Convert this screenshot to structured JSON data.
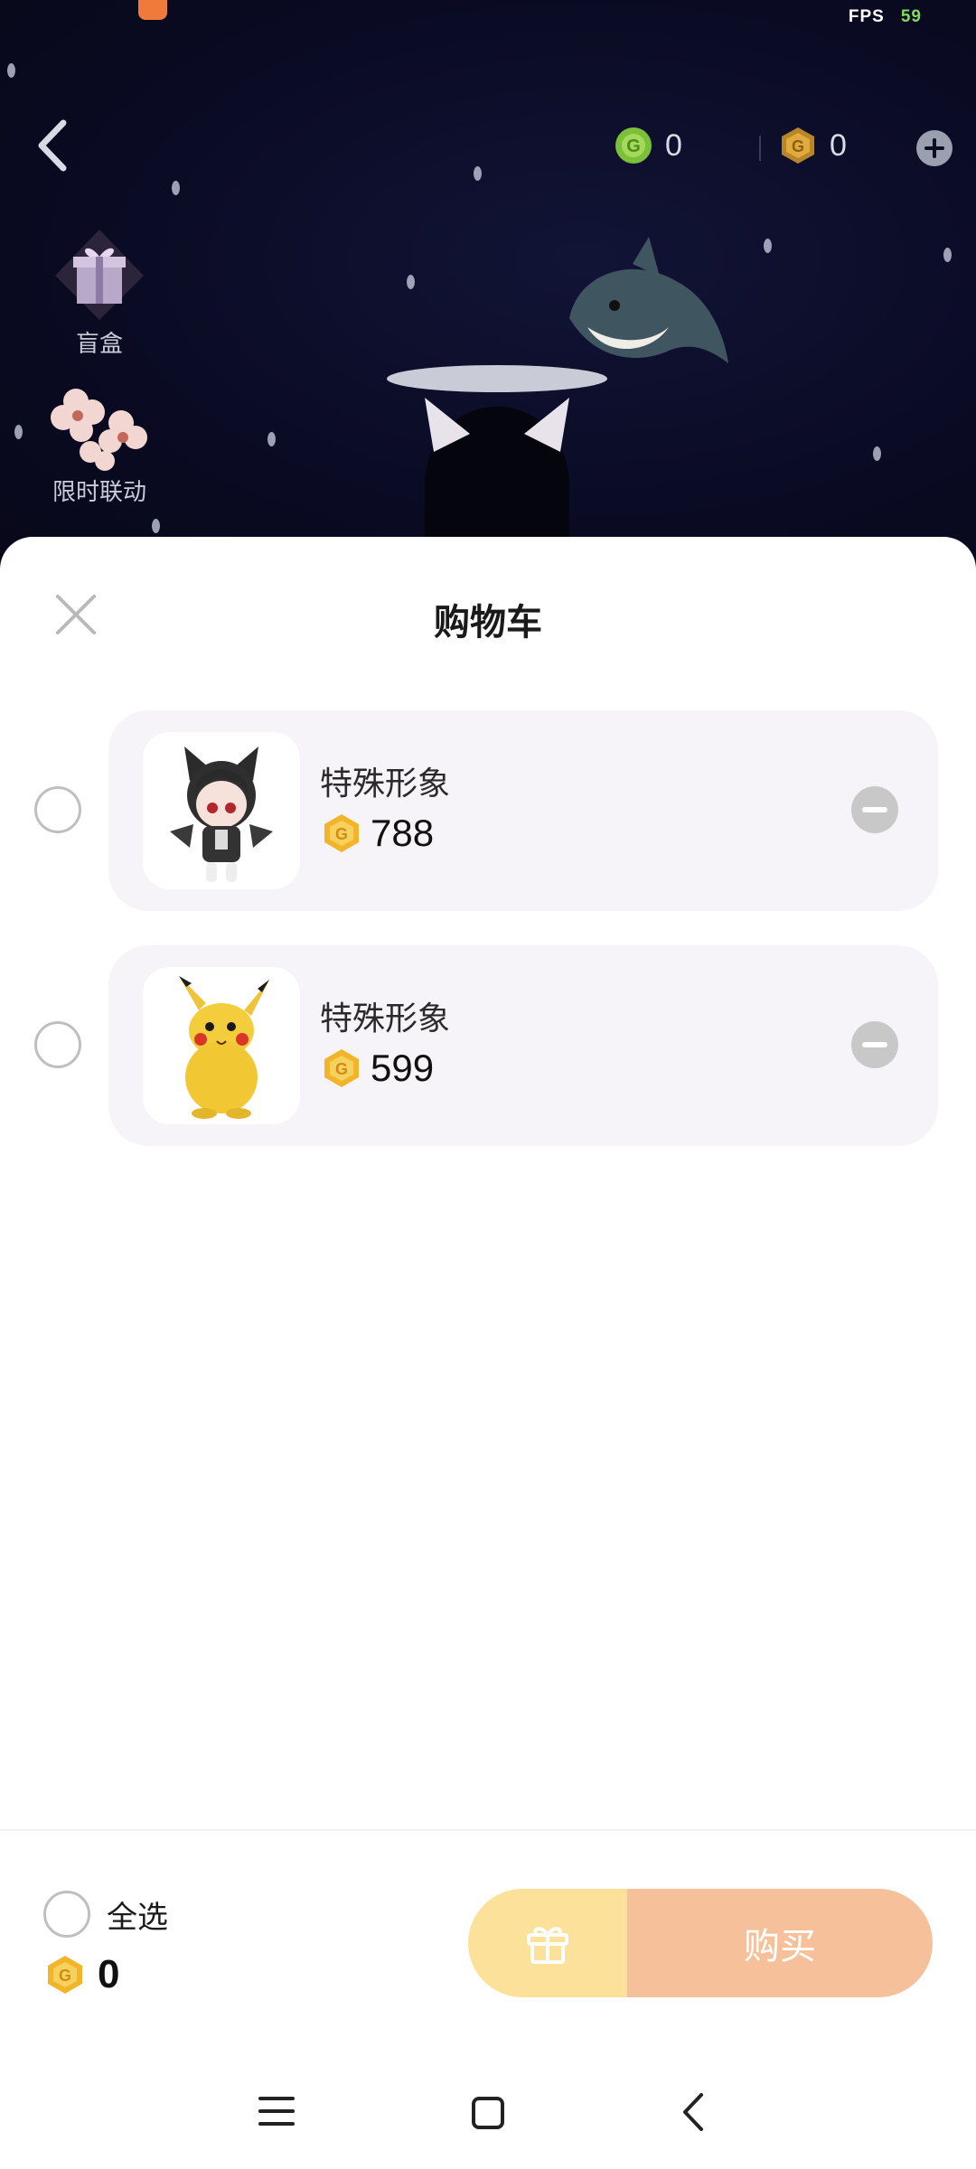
{
  "status_bar": {
    "fps_label": "FPS",
    "fps_value": "59"
  },
  "game_hud": {
    "currency_green": {
      "icon": "green-coin-icon",
      "amount": "0"
    },
    "currency_gold": {
      "icon": "gold-coin-icon",
      "amount": "0"
    },
    "side_entries": [
      {
        "label": "盲盒",
        "icon": "gift-box-icon"
      },
      {
        "label": "限时联动",
        "icon": "flower-icon"
      }
    ]
  },
  "cart": {
    "title": "购物车",
    "items": [
      {
        "name": "特殊形象",
        "price": "788",
        "currency_icon": "gold-coin-icon",
        "thumb": "cat-girl-avatar"
      },
      {
        "name": "特殊形象",
        "price": "599",
        "currency_icon": "gold-coin-icon",
        "thumb": "pikachu-avatar"
      }
    ],
    "select_all_label": "全选",
    "total": "0",
    "buy_label": "购买"
  },
  "colors": {
    "gift_button": "#fbe19a",
    "buy_button": "#f6c09a",
    "card_bg": "#f6f4f9",
    "coin_gold": "#f2b52a"
  }
}
